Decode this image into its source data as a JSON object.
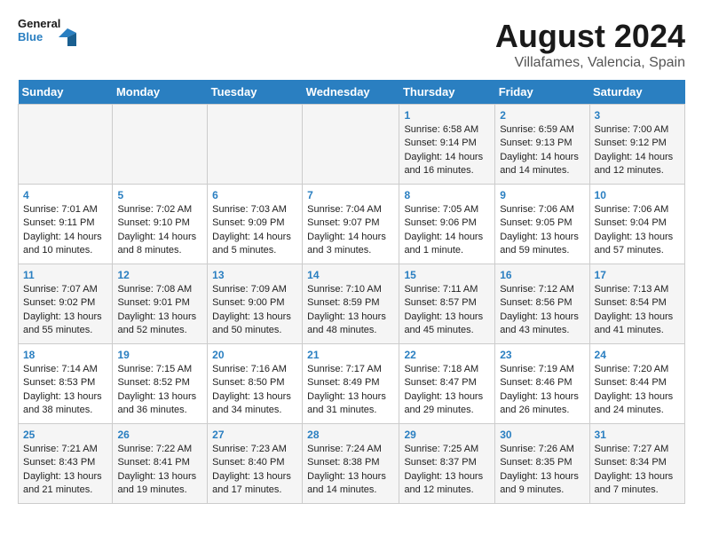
{
  "logo": {
    "line1": "General",
    "line2": "Blue"
  },
  "title": "August 2024",
  "subtitle": "Villafames, Valencia, Spain",
  "weekdays": [
    "Sunday",
    "Monday",
    "Tuesday",
    "Wednesday",
    "Thursday",
    "Friday",
    "Saturday"
  ],
  "weeks": [
    [
      {
        "day": "",
        "sunrise": "",
        "sunset": "",
        "daylight": ""
      },
      {
        "day": "",
        "sunrise": "",
        "sunset": "",
        "daylight": ""
      },
      {
        "day": "",
        "sunrise": "",
        "sunset": "",
        "daylight": ""
      },
      {
        "day": "",
        "sunrise": "",
        "sunset": "",
        "daylight": ""
      },
      {
        "day": "1",
        "sunrise": "Sunrise: 6:58 AM",
        "sunset": "Sunset: 9:14 PM",
        "daylight": "Daylight: 14 hours and 16 minutes."
      },
      {
        "day": "2",
        "sunrise": "Sunrise: 6:59 AM",
        "sunset": "Sunset: 9:13 PM",
        "daylight": "Daylight: 14 hours and 14 minutes."
      },
      {
        "day": "3",
        "sunrise": "Sunrise: 7:00 AM",
        "sunset": "Sunset: 9:12 PM",
        "daylight": "Daylight: 14 hours and 12 minutes."
      }
    ],
    [
      {
        "day": "4",
        "sunrise": "Sunrise: 7:01 AM",
        "sunset": "Sunset: 9:11 PM",
        "daylight": "Daylight: 14 hours and 10 minutes."
      },
      {
        "day": "5",
        "sunrise": "Sunrise: 7:02 AM",
        "sunset": "Sunset: 9:10 PM",
        "daylight": "Daylight: 14 hours and 8 minutes."
      },
      {
        "day": "6",
        "sunrise": "Sunrise: 7:03 AM",
        "sunset": "Sunset: 9:09 PM",
        "daylight": "Daylight: 14 hours and 5 minutes."
      },
      {
        "day": "7",
        "sunrise": "Sunrise: 7:04 AM",
        "sunset": "Sunset: 9:07 PM",
        "daylight": "Daylight: 14 hours and 3 minutes."
      },
      {
        "day": "8",
        "sunrise": "Sunrise: 7:05 AM",
        "sunset": "Sunset: 9:06 PM",
        "daylight": "Daylight: 14 hours and 1 minute."
      },
      {
        "day": "9",
        "sunrise": "Sunrise: 7:06 AM",
        "sunset": "Sunset: 9:05 PM",
        "daylight": "Daylight: 13 hours and 59 minutes."
      },
      {
        "day": "10",
        "sunrise": "Sunrise: 7:06 AM",
        "sunset": "Sunset: 9:04 PM",
        "daylight": "Daylight: 13 hours and 57 minutes."
      }
    ],
    [
      {
        "day": "11",
        "sunrise": "Sunrise: 7:07 AM",
        "sunset": "Sunset: 9:02 PM",
        "daylight": "Daylight: 13 hours and 55 minutes."
      },
      {
        "day": "12",
        "sunrise": "Sunrise: 7:08 AM",
        "sunset": "Sunset: 9:01 PM",
        "daylight": "Daylight: 13 hours and 52 minutes."
      },
      {
        "day": "13",
        "sunrise": "Sunrise: 7:09 AM",
        "sunset": "Sunset: 9:00 PM",
        "daylight": "Daylight: 13 hours and 50 minutes."
      },
      {
        "day": "14",
        "sunrise": "Sunrise: 7:10 AM",
        "sunset": "Sunset: 8:59 PM",
        "daylight": "Daylight: 13 hours and 48 minutes."
      },
      {
        "day": "15",
        "sunrise": "Sunrise: 7:11 AM",
        "sunset": "Sunset: 8:57 PM",
        "daylight": "Daylight: 13 hours and 45 minutes."
      },
      {
        "day": "16",
        "sunrise": "Sunrise: 7:12 AM",
        "sunset": "Sunset: 8:56 PM",
        "daylight": "Daylight: 13 hours and 43 minutes."
      },
      {
        "day": "17",
        "sunrise": "Sunrise: 7:13 AM",
        "sunset": "Sunset: 8:54 PM",
        "daylight": "Daylight: 13 hours and 41 minutes."
      }
    ],
    [
      {
        "day": "18",
        "sunrise": "Sunrise: 7:14 AM",
        "sunset": "Sunset: 8:53 PM",
        "daylight": "Daylight: 13 hours and 38 minutes."
      },
      {
        "day": "19",
        "sunrise": "Sunrise: 7:15 AM",
        "sunset": "Sunset: 8:52 PM",
        "daylight": "Daylight: 13 hours and 36 minutes."
      },
      {
        "day": "20",
        "sunrise": "Sunrise: 7:16 AM",
        "sunset": "Sunset: 8:50 PM",
        "daylight": "Daylight: 13 hours and 34 minutes."
      },
      {
        "day": "21",
        "sunrise": "Sunrise: 7:17 AM",
        "sunset": "Sunset: 8:49 PM",
        "daylight": "Daylight: 13 hours and 31 minutes."
      },
      {
        "day": "22",
        "sunrise": "Sunrise: 7:18 AM",
        "sunset": "Sunset: 8:47 PM",
        "daylight": "Daylight: 13 hours and 29 minutes."
      },
      {
        "day": "23",
        "sunrise": "Sunrise: 7:19 AM",
        "sunset": "Sunset: 8:46 PM",
        "daylight": "Daylight: 13 hours and 26 minutes."
      },
      {
        "day": "24",
        "sunrise": "Sunrise: 7:20 AM",
        "sunset": "Sunset: 8:44 PM",
        "daylight": "Daylight: 13 hours and 24 minutes."
      }
    ],
    [
      {
        "day": "25",
        "sunrise": "Sunrise: 7:21 AM",
        "sunset": "Sunset: 8:43 PM",
        "daylight": "Daylight: 13 hours and 21 minutes."
      },
      {
        "day": "26",
        "sunrise": "Sunrise: 7:22 AM",
        "sunset": "Sunset: 8:41 PM",
        "daylight": "Daylight: 13 hours and 19 minutes."
      },
      {
        "day": "27",
        "sunrise": "Sunrise: 7:23 AM",
        "sunset": "Sunset: 8:40 PM",
        "daylight": "Daylight: 13 hours and 17 minutes."
      },
      {
        "day": "28",
        "sunrise": "Sunrise: 7:24 AM",
        "sunset": "Sunset: 8:38 PM",
        "daylight": "Daylight: 13 hours and 14 minutes."
      },
      {
        "day": "29",
        "sunrise": "Sunrise: 7:25 AM",
        "sunset": "Sunset: 8:37 PM",
        "daylight": "Daylight: 13 hours and 12 minutes."
      },
      {
        "day": "30",
        "sunrise": "Sunrise: 7:26 AM",
        "sunset": "Sunset: 8:35 PM",
        "daylight": "Daylight: 13 hours and 9 minutes."
      },
      {
        "day": "31",
        "sunrise": "Sunrise: 7:27 AM",
        "sunset": "Sunset: 8:34 PM",
        "daylight": "Daylight: 13 hours and 7 minutes."
      }
    ]
  ]
}
